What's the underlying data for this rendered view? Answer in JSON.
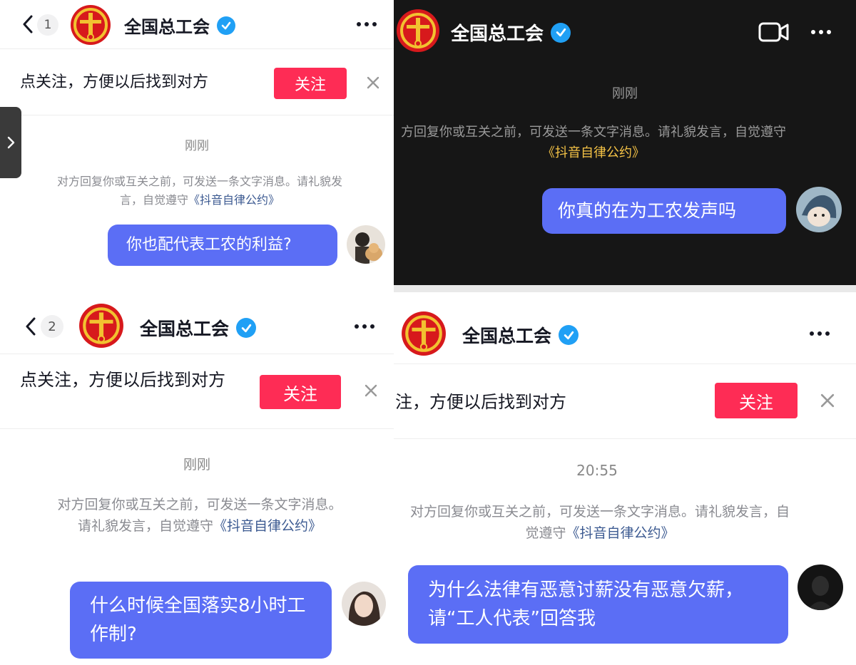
{
  "app_name": "全国总工会",
  "panels": {
    "p1": {
      "count": "1",
      "title": "全国总工会",
      "follow_text": "点关注，方便以后找到对方",
      "follow_btn": "关注",
      "time": "刚刚",
      "notice_text": "对方回复你或互关之前，可发送一条文字消息。请礼貌发言，自觉遵守",
      "notice_link": "《抖音自律公约》",
      "message": "你也配代表工农的利益?"
    },
    "p2": {
      "title": "全国总工会",
      "time": "刚刚",
      "notice_text": "方回复你或互关之前，可发送一条文字消息。请礼貌发言，自觉遵守",
      "notice_link": "《抖音自律公约》",
      "message": "你真的在为工农发声吗"
    },
    "p3": {
      "count": "2",
      "title": "全国总工会",
      "follow_text": "点关注，方便以后找到对方",
      "follow_btn": "关注",
      "time": "刚刚",
      "notice_text": "对方回复你或互关之前，可发送一条文字消息。请礼貌发言，自觉遵守",
      "notice_link": "《抖音自律公约》",
      "message": "什么时候全国落实8小时工作制?"
    },
    "p4": {
      "title": "全国总工会",
      "follow_text": "注，方便以后找到对方",
      "follow_btn": "关注",
      "time": "20:55",
      "notice_text": "对方回复你或互关之前，可发送一条文字消息。请礼貌发言，自觉遵守",
      "notice_link": "《抖音自律公约》",
      "message": "为什么法律有恶意讨薪没有恶意欠薪，请“工人代表”回答我"
    }
  },
  "colors": {
    "follow_red": "#fe2c55",
    "bubble_blue": "#5b6ef5",
    "verified_blue": "#20a0f5",
    "link_blue": "#3c5a91",
    "link_gold": "#f5c346",
    "logo_red": "#d7191c",
    "logo_gold": "#f2c230"
  },
  "icons": [
    "back-chevron-icon",
    "verified-badge-icon",
    "more-dots-icon",
    "video-call-icon",
    "close-icon",
    "side-expand-chevron-icon"
  ]
}
